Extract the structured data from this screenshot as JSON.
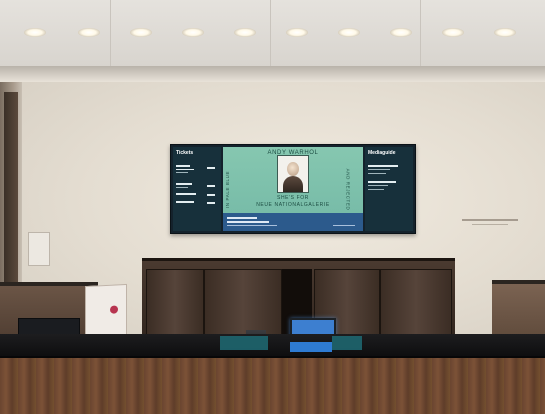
{
  "screen": {
    "left_title": "Tickets",
    "right_title": "Mediaguide",
    "banner_top": "ANDY WARHOL",
    "banner_left": "IN PALE BLUE",
    "banner_right": "AND REJECTED",
    "banner_bottom_1": "SHE'S FOR",
    "banner_bottom_2": "NEUE NATIONALGALERIE"
  },
  "colors": {
    "screen_center": "#80c2ac",
    "screen_side": "#17303b",
    "screen_strip": "#2c5a8c",
    "desk_tablet": "#3d7fd0"
  }
}
